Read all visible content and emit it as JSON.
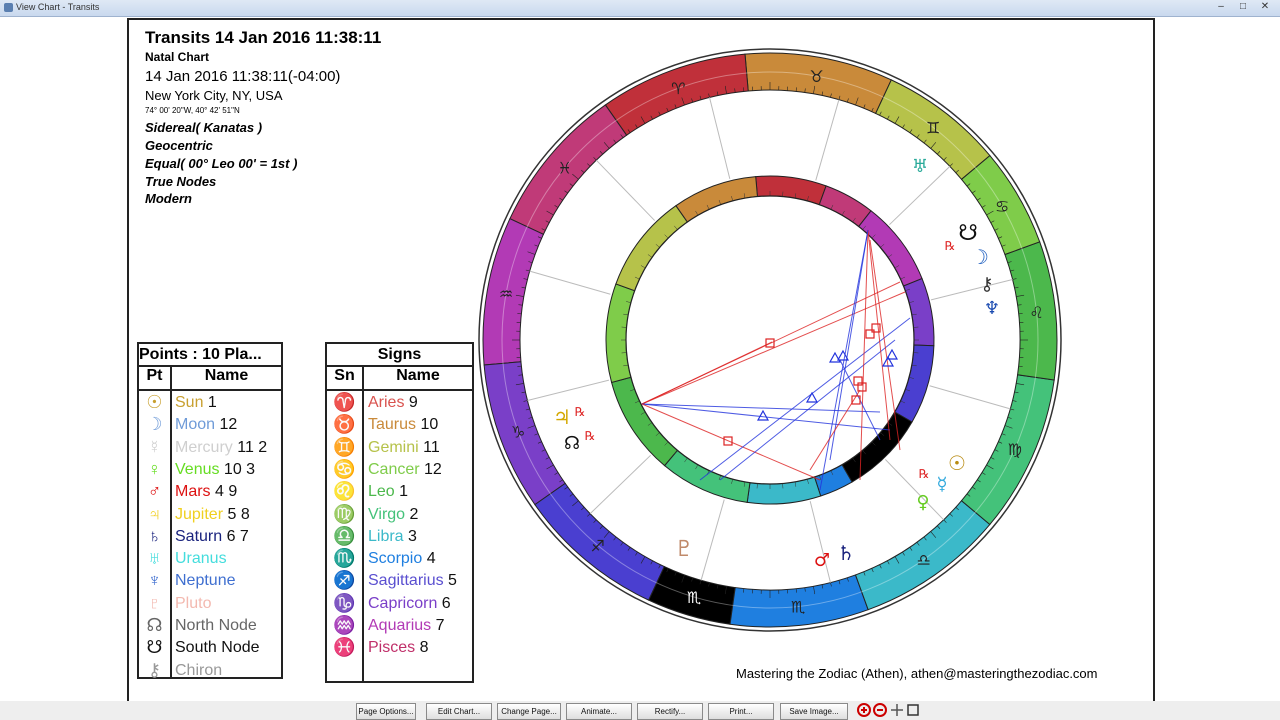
{
  "window": {
    "title": "View Chart - Transits"
  },
  "header": {
    "title": "Transits 14 Jan 2016 11:38:11",
    "subtitle": "Natal Chart",
    "datetime": "14 Jan 2016 11:38:11(-04:00)",
    "location": "New York City, NY, USA",
    "coords": "74° 00' 20\"W, 40° 42' 51\"N",
    "settings": [
      "Sidereal( Kanatas )",
      "Geocentric",
      "Equal( 00° Leo 00' = 1st )",
      "True Nodes",
      "Modern"
    ]
  },
  "points_table": {
    "caption": "Points : 10 Pla...",
    "col_pt": "Pt",
    "col_name": "Name",
    "rows": [
      {
        "glyph": "☉",
        "name": "Sun",
        "houses": "1",
        "color": "#c8a030"
      },
      {
        "glyph": "☽",
        "name": "Moon",
        "houses": "12",
        "color": "#6f9bd8"
      },
      {
        "glyph": "☿",
        "name": "Mercury",
        "houses": "11 2",
        "color": "#cfcfcf"
      },
      {
        "glyph": "♀",
        "name": "Venus",
        "houses": "10 3",
        "color": "#66dd22"
      },
      {
        "glyph": "♂",
        "name": "Mars",
        "houses": "4 9",
        "color": "#dd1111"
      },
      {
        "glyph": "♃",
        "name": "Jupiter",
        "houses": "5 8",
        "color": "#f0d020"
      },
      {
        "glyph": "♄",
        "name": "Saturn",
        "houses": "6 7",
        "color": "#1a237e"
      },
      {
        "glyph": "♅",
        "name": "Uranus",
        "houses": "",
        "color": "#44dddd"
      },
      {
        "glyph": "♆",
        "name": "Neptune",
        "houses": "",
        "color": "#3f6fd0"
      },
      {
        "glyph": "♇",
        "name": "Pluto",
        "houses": "",
        "color": "#f3b9b0"
      },
      {
        "glyph": "☊",
        "name": "North Node",
        "houses": "",
        "color": "#666666"
      },
      {
        "glyph": "☋",
        "name": "South Node",
        "houses": "",
        "color": "#111111"
      },
      {
        "glyph": "⚷",
        "name": "Chiron",
        "houses": "",
        "color": "#999999"
      }
    ]
  },
  "signs_table": {
    "caption": "Signs",
    "col_sn": "Sn",
    "col_name": "Name",
    "rows": [
      {
        "glyph": "♈",
        "name": "Aries",
        "num": "9",
        "color": "#d9534f"
      },
      {
        "glyph": "♉",
        "name": "Taurus",
        "num": "10",
        "color": "#c98a3a"
      },
      {
        "glyph": "♊",
        "name": "Gemini",
        "num": "11",
        "color": "#b6c24a"
      },
      {
        "glyph": "♋",
        "name": "Cancer",
        "num": "12",
        "color": "#7fcc4a"
      },
      {
        "glyph": "♌",
        "name": "Leo",
        "num": "1",
        "color": "#4cb84c"
      },
      {
        "glyph": "♍",
        "name": "Virgo",
        "num": "2",
        "color": "#44c27a"
      },
      {
        "glyph": "♎",
        "name": "Libra",
        "num": "3",
        "color": "#3bb9c9"
      },
      {
        "glyph": "♏",
        "name": "Scorpio",
        "num": "4",
        "color": "#1f7fe0"
      },
      {
        "glyph": "♐",
        "name": "Sagittarius",
        "num": "5",
        "color": "#5a4fd0"
      },
      {
        "glyph": "♑",
        "name": "Capricorn",
        "num": "6",
        "color": "#7a3fc8"
      },
      {
        "glyph": "♒",
        "name": "Aquarius",
        "num": "7",
        "color": "#b23ab5"
      },
      {
        "glyph": "♓",
        "name": "Pisces",
        "num": "8",
        "color": "#c0306a"
      }
    ]
  },
  "wheel": {
    "outer_signs": [
      {
        "glyph": "♉",
        "color": "#c98a3a"
      },
      {
        "glyph": "♈",
        "color": "#c0303a"
      },
      {
        "glyph": "♓",
        "color": "#c03a78"
      },
      {
        "glyph": "♒",
        "color": "#b23ab5"
      },
      {
        "glyph": "♑",
        "color": "#7a3fc8"
      },
      {
        "glyph": "♐",
        "color": "#4a3fd0"
      },
      {
        "glyph": "♏",
        "color": "#000000"
      },
      {
        "glyph": "♏",
        "color": "#1f7fe0"
      },
      {
        "glyph": "♎",
        "color": "#3bb9c9"
      },
      {
        "glyph": "♍",
        "color": "#44c27a"
      },
      {
        "glyph": "♌",
        "color": "#4cb84c"
      },
      {
        "glyph": "♋",
        "color": "#7fcc4a"
      },
      {
        "glyph": "♊",
        "color": "#b6c24a"
      }
    ],
    "transit_glyphs": [
      {
        "glyph": "♅",
        "color": "#2aaa9a"
      },
      {
        "glyph": "☋",
        "color": "#111111"
      },
      {
        "glyph": "☽",
        "color": "#2060c0"
      },
      {
        "glyph": "⚷",
        "color": "#333333"
      },
      {
        "glyph": "♆",
        "color": "#1a4ab0"
      },
      {
        "glyph": "♃",
        "color": "#d4a800"
      },
      {
        "glyph": "☊",
        "color": "#111111"
      },
      {
        "glyph": "☉",
        "color": "#b88a10"
      },
      {
        "glyph": "♀",
        "color": "#66cc22"
      },
      {
        "glyph": "♄",
        "color": "#1a237e"
      },
      {
        "glyph": "♂",
        "color": "#dd1111"
      },
      {
        "glyph": "♇",
        "color": "#c08a6a"
      },
      {
        "glyph": "☿",
        "color": "#33aadd"
      }
    ],
    "retro_mark": "℞",
    "colors": {
      "aspect_red": "#dd2222",
      "aspect_blue": "#2233dd"
    }
  },
  "credit": "Mastering the Zodiac (Athen), athen@masteringthezodiac.com",
  "toolbar": {
    "buttons": [
      "Page Options...",
      "Edit Chart...",
      "Change Page...",
      "Animate...",
      "Rectify...",
      "Print...",
      "Save Image..."
    ]
  }
}
